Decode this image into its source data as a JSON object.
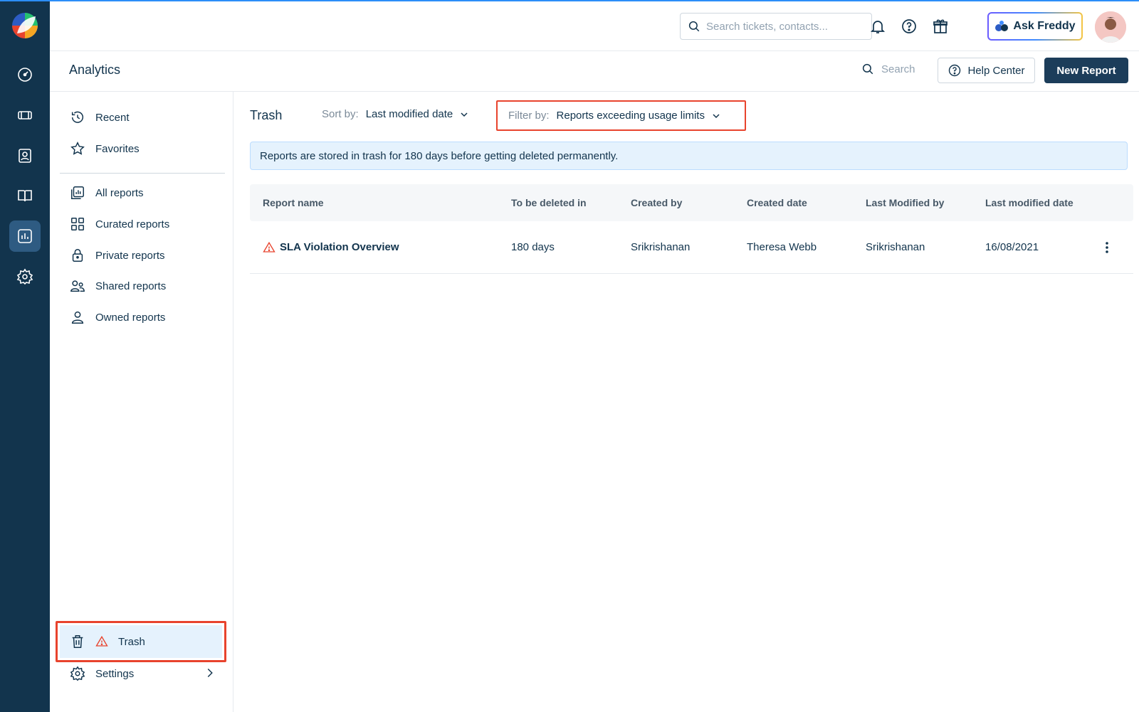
{
  "global_search": {
    "placeholder": "Search tickets, contacts..."
  },
  "ask_freddy_label": "Ask Freddy",
  "header": {
    "title": "Analytics",
    "search_label": "Search",
    "help_center_label": "Help Center",
    "new_report_label": "New Report"
  },
  "sidebar": {
    "items": [
      {
        "label": "Recent",
        "icon": "recent-icon"
      },
      {
        "label": "Favorites",
        "icon": "star-icon"
      },
      {
        "label": "All reports",
        "icon": "all-reports-icon"
      },
      {
        "label": "Curated reports",
        "icon": "grid-icon"
      },
      {
        "label": "Private reports",
        "icon": "lock-icon"
      },
      {
        "label": "Shared reports",
        "icon": "users-icon"
      },
      {
        "label": "Owned reports",
        "icon": "user-icon"
      }
    ],
    "trash_label": "Trash",
    "settings_label": "Settings"
  },
  "main": {
    "title": "Trash",
    "sort_label": "Sort by:",
    "sort_value": "Last modified date",
    "filter_label": "Filter by:",
    "filter_value": "Reports exceeding usage limits",
    "info": "Reports are stored in trash for 180 days before getting deleted permanently."
  },
  "table": {
    "columns": [
      "Report name",
      "To be deleted in",
      "Created by",
      "Created date",
      "Last Modified by",
      "Last modified date"
    ],
    "rows": [
      [
        "SLA Violation Overview",
        "180 days",
        "Srikrishanan",
        "Theresa Webb",
        "Srikrishanan",
        "16/08/2021"
      ]
    ]
  },
  "colors": {
    "rail_bg": "#12344d",
    "primary_button": "#1c3d5a",
    "highlight_red": "#e8432d",
    "info_bg": "#e5f2fd"
  }
}
